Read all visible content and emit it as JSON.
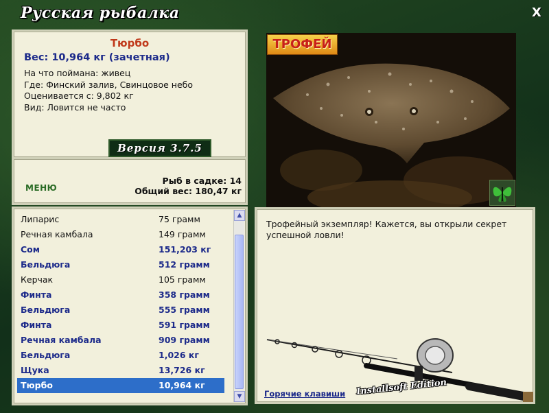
{
  "app": {
    "title": "Русская рыбалка",
    "close_label": "X",
    "version": "Версия 3.7.5"
  },
  "fish": {
    "name": "Тюрбо",
    "weight_line": "Вес: 10,964 кг (зачетная)",
    "info": [
      "На что поймана: живец",
      "Где: Финский залив, Свинцовое небо",
      "Оценивается с: 9,802 кг",
      "Вид: Ловится не часто"
    ]
  },
  "menu": {
    "button_label": "МЕНЮ",
    "fish_count": "Рыб в садке: 14",
    "total_weight": "Общий вес: 180,47 кг"
  },
  "photo": {
    "trophy_label": "ТРОФЕЙ",
    "butterfly_icon": "butterfly-icon"
  },
  "catch_list": [
    {
      "name": "Липарис",
      "weight": "75 грамм",
      "style": "normal"
    },
    {
      "name": "Речная камбала",
      "weight": "149 грамм",
      "style": "normal"
    },
    {
      "name": "Сом",
      "weight": "151,203 кг",
      "style": "bold"
    },
    {
      "name": "Бельдюга",
      "weight": "512 грамм",
      "style": "bold"
    },
    {
      "name": "Керчак",
      "weight": "105 грамм",
      "style": "normal"
    },
    {
      "name": "Финта",
      "weight": "358 грамм",
      "style": "bold"
    },
    {
      "name": "Бельдюга",
      "weight": "555 грамм",
      "style": "bold"
    },
    {
      "name": "Финта",
      "weight": "591 грамм",
      "style": "bold"
    },
    {
      "name": "Речная камбала",
      "weight": "909 грамм",
      "style": "bold"
    },
    {
      "name": "Бельдюга",
      "weight": "1,026 кг",
      "style": "bold"
    },
    {
      "name": "Щука",
      "weight": "13,726 кг",
      "style": "bold"
    },
    {
      "name": "Тюрбо",
      "weight": "10,964 кг",
      "style": "selected"
    }
  ],
  "description": {
    "text": "Трофейный экземпляр! Кажется, вы открыли секрет успешной ловли!",
    "hotkeys_label": "Горячие клавиши",
    "edition_label": "Installsoft Edition"
  },
  "colors": {
    "accent_blue": "#1c2a8a",
    "fish_name_red": "#c0391b",
    "selection": "#2d6ec9",
    "panel": "#f2f0dc"
  }
}
